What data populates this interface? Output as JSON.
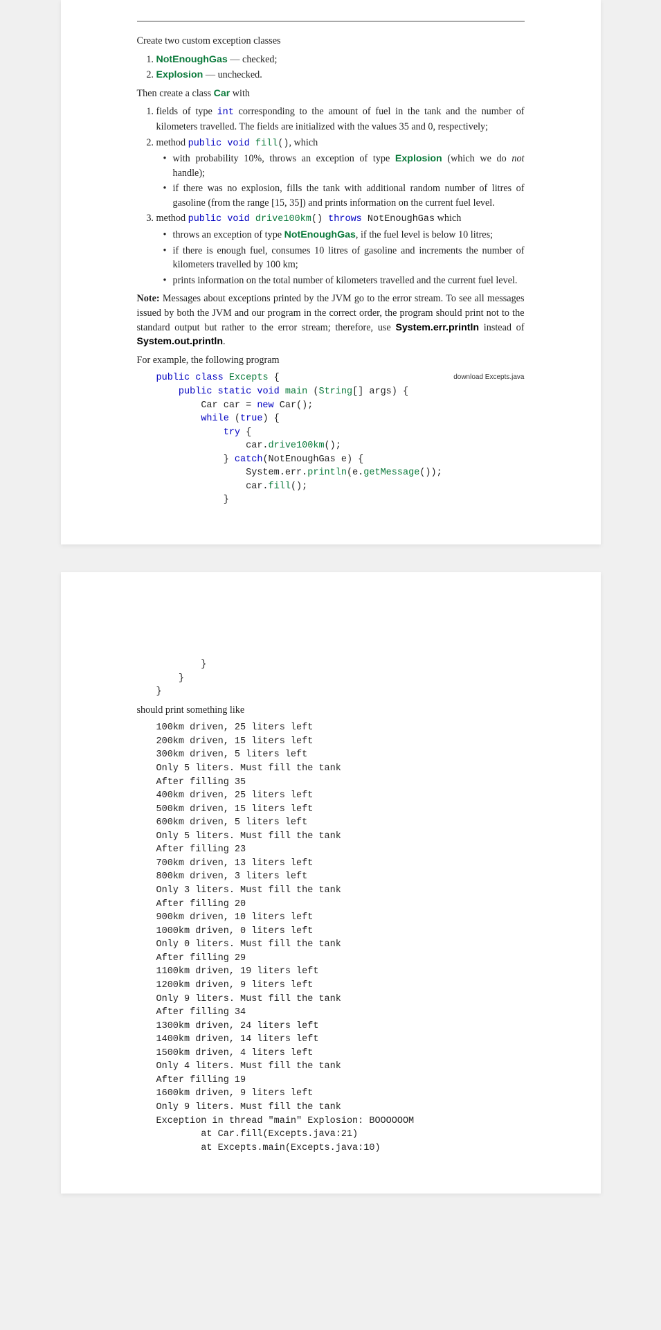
{
  "intro": "Create two custom exception classes",
  "exc_list": {
    "items": [
      {
        "name": "NotEnoughGas",
        "sep": " — ",
        "desc": "checked;"
      },
      {
        "name": "Explosion",
        "sep": " — ",
        "desc": "unchecked."
      }
    ]
  },
  "then": {
    "pre": "Then create a class ",
    "cls": "Car",
    "post": " with"
  },
  "car_steps": {
    "s1": {
      "pre": "fields of type ",
      "kw": "int",
      "post": " corresponding to the amount of fuel in the tank and the number of kilometers travelled. The fields are initialized with the values 35 and 0, respectively;"
    },
    "s2": {
      "pre": "method ",
      "sig_kw1": "public",
      "sig_kw2": "void",
      "sig_name": "fill",
      "sig_parens": "()",
      "post": ", which",
      "b1a": "with probability 10%, throws an exception of type ",
      "b1b": "Explosion",
      "b1c": " (which we do ",
      "b1d": "not",
      "b1e": " handle);",
      "b2": "if there was no explosion, fills the tank with additional random number of litres of gasoline (from the range [15, 35]) and prints information on the current fuel level."
    },
    "s3": {
      "pre": "method ",
      "sig_kw1": "public",
      "sig_kw2": "void",
      "sig_name": "drive100km",
      "sig_parens": "()",
      "sig_throws_kw": "throws",
      "sig_throws_type": "NotEnoughGas",
      "post": " which",
      "b1a": "throws an exception of type ",
      "b1b": "NotEnoughGas",
      "b1c": ", if the fuel level is below 10 litres;",
      "b2": "if there is enough fuel, consumes 10 litres of gasoline and increments the number of kilometers travelled by 100 km;",
      "b3": "prints information on the total number of kilometers travelled and the current fuel level."
    }
  },
  "note": {
    "label": "Note:",
    "body1": " Messages about exceptions printed by the JVM go to the error stream. To see all messages issued by both the JVM and our program in the correct order, the program should print not to the standard output but rather to the error stream; therefore, use ",
    "err": "System.err.println",
    "mid": " instead of ",
    "out": "System.out.println",
    "end": "."
  },
  "eg_intro": "For example, the following program",
  "download": "download Excepts.java",
  "code_page1": {
    "l1_kw1": "public",
    "l1_kw2": "class",
    "l1_name": "Excepts",
    "l1_brace": " {",
    "l2_kw1": "public",
    "l2_kw2": "static",
    "l2_kw3": "void",
    "l2_name": "main",
    "l2_args_open": " (",
    "l2_argtype": "String",
    "l2_argbr": "[]",
    "l2_argname": " args) {",
    "l3a": "Car car = ",
    "l3kw": "new",
    "l3b": " Car();",
    "l4kw": "while",
    "l4a": " (",
    "l4kw2": "true",
    "l4b": ") {",
    "l5kw": "try",
    "l5b": " {",
    "l6a": "car.",
    "l6m": "drive100km",
    "l6b": "();",
    "l7a": "} ",
    "l7kw": "catch",
    "l7b": "(NotEnoughGas e) {",
    "l8a": "System.err.",
    "l8m": "println",
    "l8b": "(e.",
    "l8m2": "getMessage",
    "l8c": "());",
    "l9a": "car.",
    "l9m": "fill",
    "l9b": "();",
    "l10": "}"
  },
  "code_page2": {
    "l1": "        }",
    "l2": "    }",
    "l3": "}"
  },
  "should": "should print something like",
  "output_lines": [
    "100km driven, 25 liters left",
    "200km driven, 15 liters left",
    "300km driven, 5 liters left",
    "Only 5 liters. Must fill the tank",
    "After filling 35",
    "400km driven, 25 liters left",
    "500km driven, 15 liters left",
    "600km driven, 5 liters left",
    "Only 5 liters. Must fill the tank",
    "After filling 23",
    "700km driven, 13 liters left",
    "800km driven, 3 liters left",
    "Only 3 liters. Must fill the tank",
    "After filling 20",
    "900km driven, 10 liters left",
    "1000km driven, 0 liters left",
    "Only 0 liters. Must fill the tank",
    "After filling 29",
    "1100km driven, 19 liters left",
    "1200km driven, 9 liters left",
    "Only 9 liters. Must fill the tank",
    "After filling 34",
    "1300km driven, 24 liters left",
    "1400km driven, 14 liters left",
    "1500km driven, 4 liters left",
    "Only 4 liters. Must fill the tank",
    "After filling 19",
    "1600km driven, 9 liters left",
    "Only 9 liters. Must fill the tank",
    "Exception in thread \"main\" Explosion: BOOOOOOM",
    "        at Car.fill(Excepts.java:21)",
    "        at Excepts.main(Excepts.java:10)"
  ]
}
